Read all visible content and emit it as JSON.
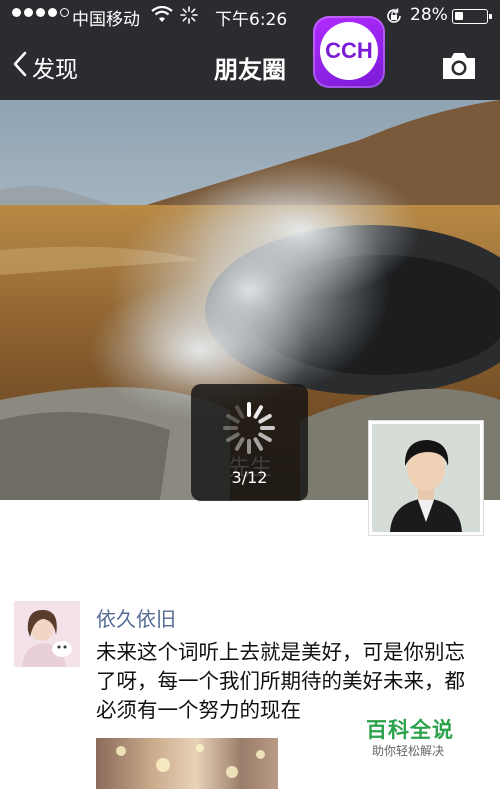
{
  "status_bar": {
    "carrier": "中国移动",
    "time": "下午6:26",
    "battery_percent": "28%",
    "battery_level": 0.28,
    "signal_bars": 4
  },
  "nav": {
    "back_label": "发现",
    "title": "朋友圈",
    "icons": {
      "back": "chevron-left-icon",
      "camera": "camera-icon"
    }
  },
  "overlay_logo": {
    "text": "CCH"
  },
  "cover": {
    "username": "先生"
  },
  "loading": {
    "counter": "3/12"
  },
  "post": {
    "author": "依久依旧",
    "text": "未来这个词听上去就是美好，可是你别忘了呀，每一个我们所期待的美好未来，都必须有一个努力的现在"
  },
  "watermark": {
    "title": "百科全说",
    "subtitle": "助你轻松解决"
  },
  "colors": {
    "nav_bg": "#2b2c30",
    "author_link": "#576b95",
    "watermark_green": "#2ba24c"
  }
}
